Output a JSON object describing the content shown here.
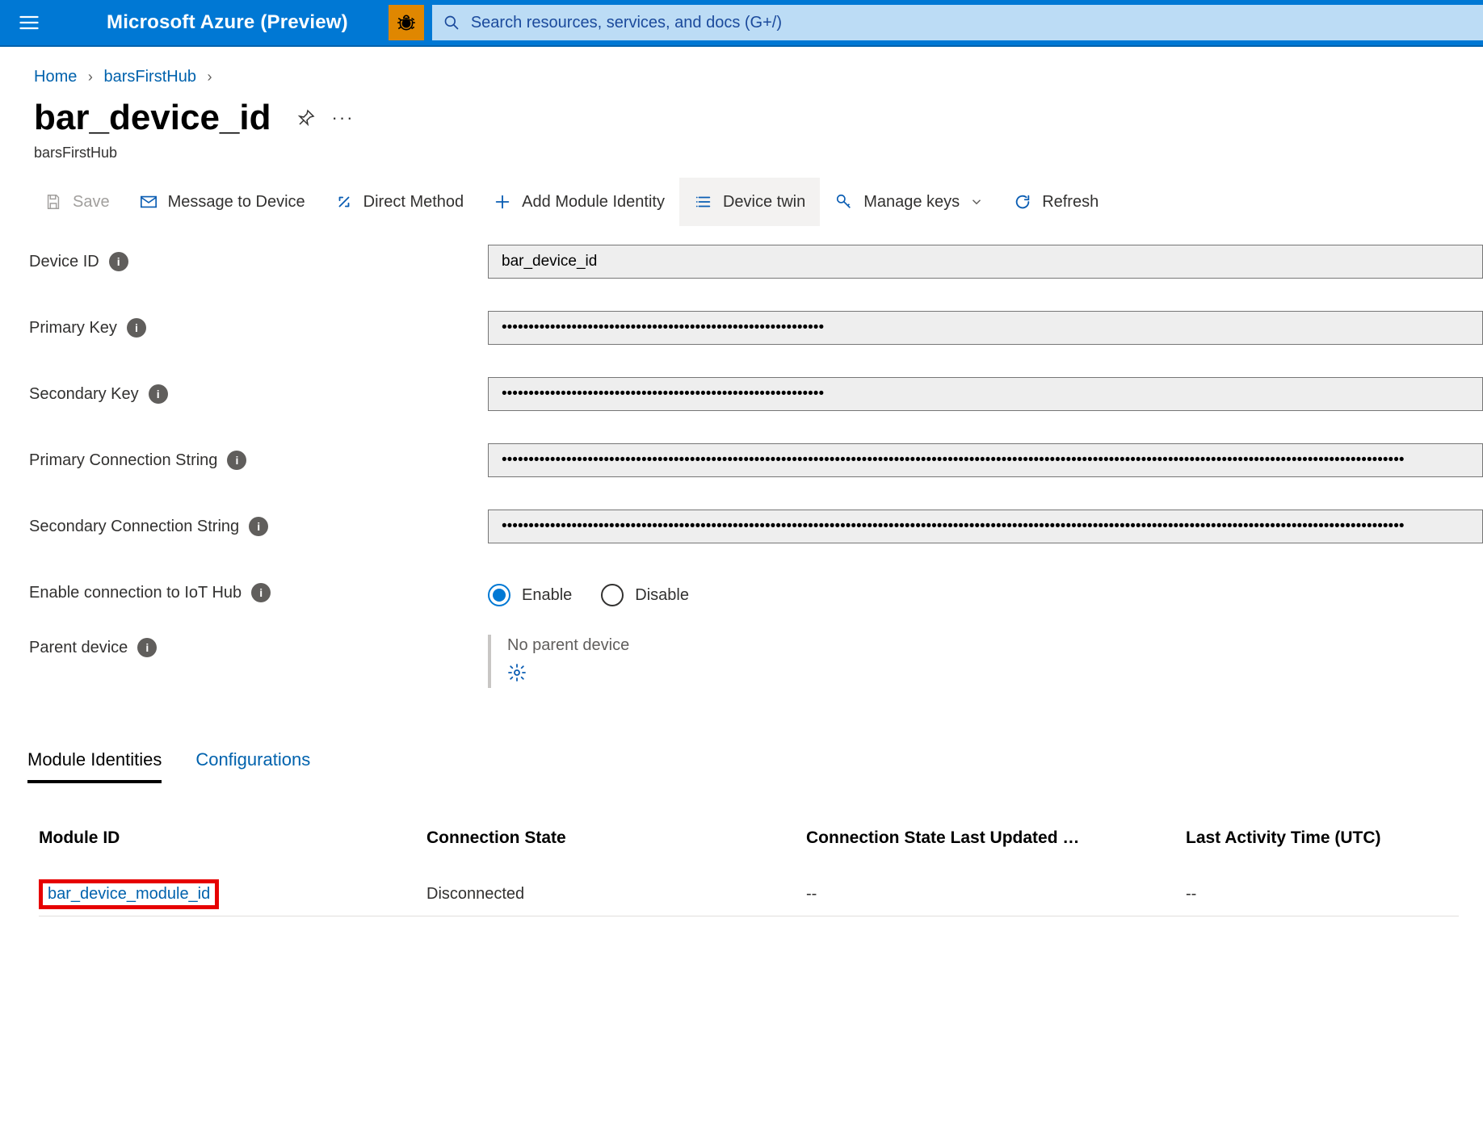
{
  "header": {
    "brand": "Microsoft Azure (Preview)",
    "search_placeholder": "Search resources, services, and docs (G+/)"
  },
  "breadcrumb": {
    "home": "Home",
    "hub": "barsFirstHub"
  },
  "page": {
    "title": "bar_device_id",
    "subtitle": "barsFirstHub"
  },
  "toolbar": {
    "save": "Save",
    "message": "Message to Device",
    "direct": "Direct Method",
    "add_module": "Add Module Identity",
    "device_twin": "Device twin",
    "manage_keys": "Manage keys",
    "refresh": "Refresh"
  },
  "form": {
    "device_id_label": "Device ID",
    "device_id_value": "bar_device_id",
    "primary_key_label": "Primary Key",
    "primary_key_value": "••••••••••••••••••••••••••••••••••••••••••••••••••••••••••••",
    "secondary_key_label": "Secondary Key",
    "secondary_key_value": "••••••••••••••••••••••••••••••••••••••••••••••••••••••••••••",
    "primary_cs_label": "Primary Connection String",
    "primary_cs_value": "••••••••••••••••••••••••••••••••••••••••••••••••••••••••••••••••••••••••••••••••••••••••••••••••••••••••••••••••••••••••••••••••••••••••••••••••••••••••••••••••••••••••",
    "secondary_cs_label": "Secondary Connection String",
    "secondary_cs_value": "••••••••••••••••••••••••••••••••••••••••••••••••••••••••••••••••••••••••••••••••••••••••••••••••••••••••••••••••••••••••••••••••••••••••••••••••••••••••••••••••••••••••",
    "enable_label": "Enable connection to IoT Hub",
    "enable_option": "Enable",
    "disable_option": "Disable",
    "parent_label": "Parent device",
    "no_parent": "No parent device"
  },
  "tabs": {
    "module_identities": "Module Identities",
    "configurations": "Configurations"
  },
  "table": {
    "cols": {
      "module_id": "Module ID",
      "conn_state": "Connection State",
      "conn_updated": "Connection State Last Updated …",
      "last_activity": "Last Activity Time (UTC)"
    },
    "row": {
      "module_id": "bar_device_module_id",
      "conn_state": "Disconnected",
      "conn_updated": "--",
      "last_activity": "--"
    }
  }
}
